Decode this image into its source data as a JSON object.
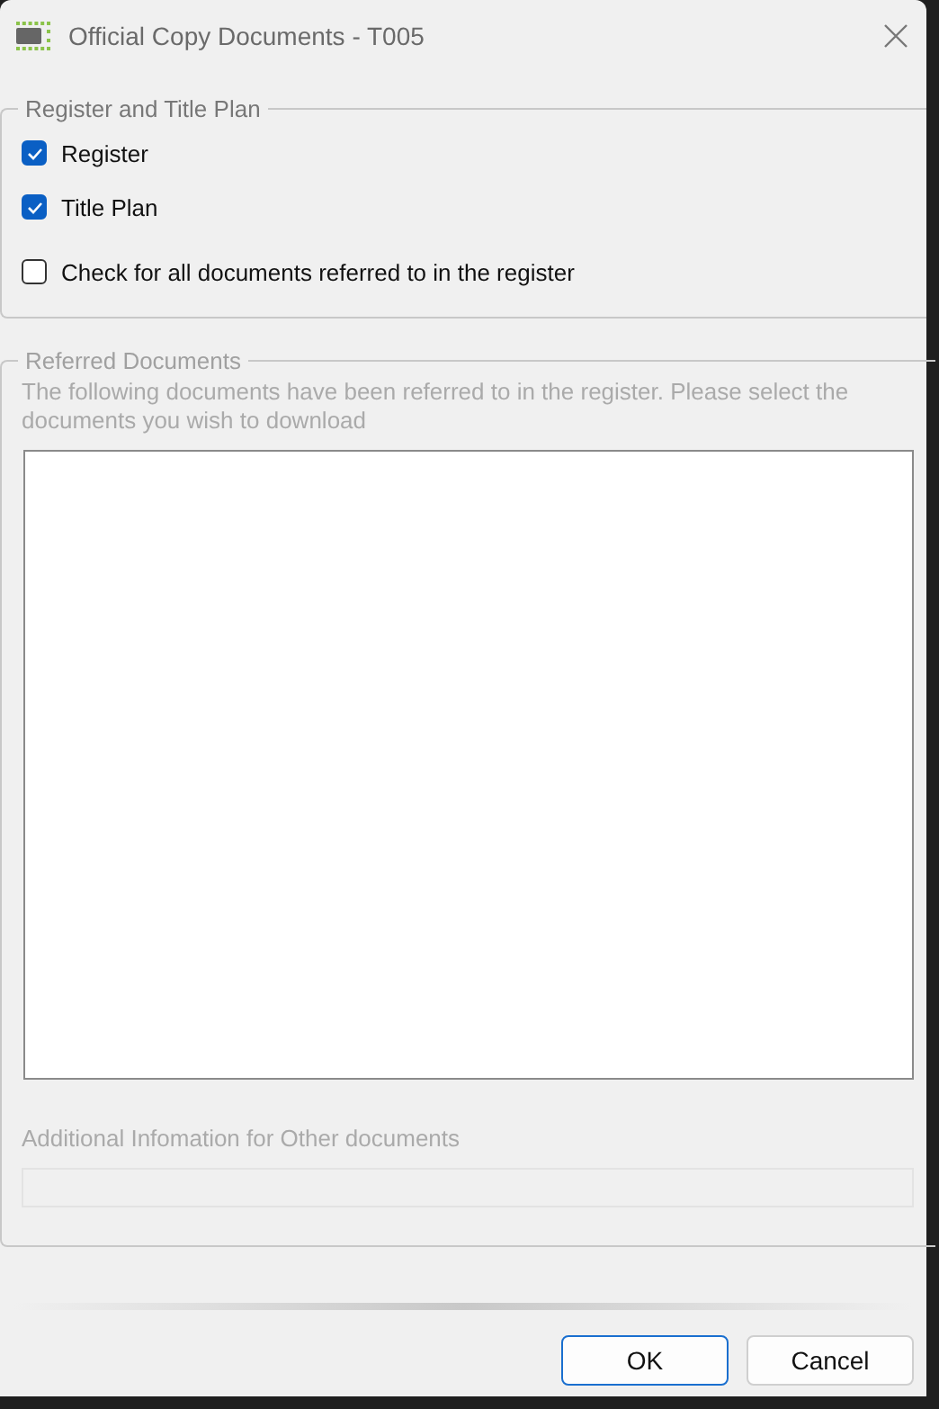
{
  "window": {
    "title": "Official Copy Documents - T005"
  },
  "register_group": {
    "legend": "Register and Title Plan",
    "checkboxes": [
      {
        "label": "Register",
        "checked": true
      },
      {
        "label": "Title Plan",
        "checked": true
      },
      {
        "label": "Check for all documents referred to in the register",
        "checked": false
      }
    ]
  },
  "referred_group": {
    "legend": "Referred Documents",
    "disabled": true,
    "description": "The following documents have been referred to in the register. Please select the documents you wish to download",
    "additional_label": "Additional Infomation for Other documents"
  },
  "buttons": [
    {
      "label": "OK",
      "default": true
    },
    {
      "label": "Cancel",
      "default": false
    }
  ]
}
